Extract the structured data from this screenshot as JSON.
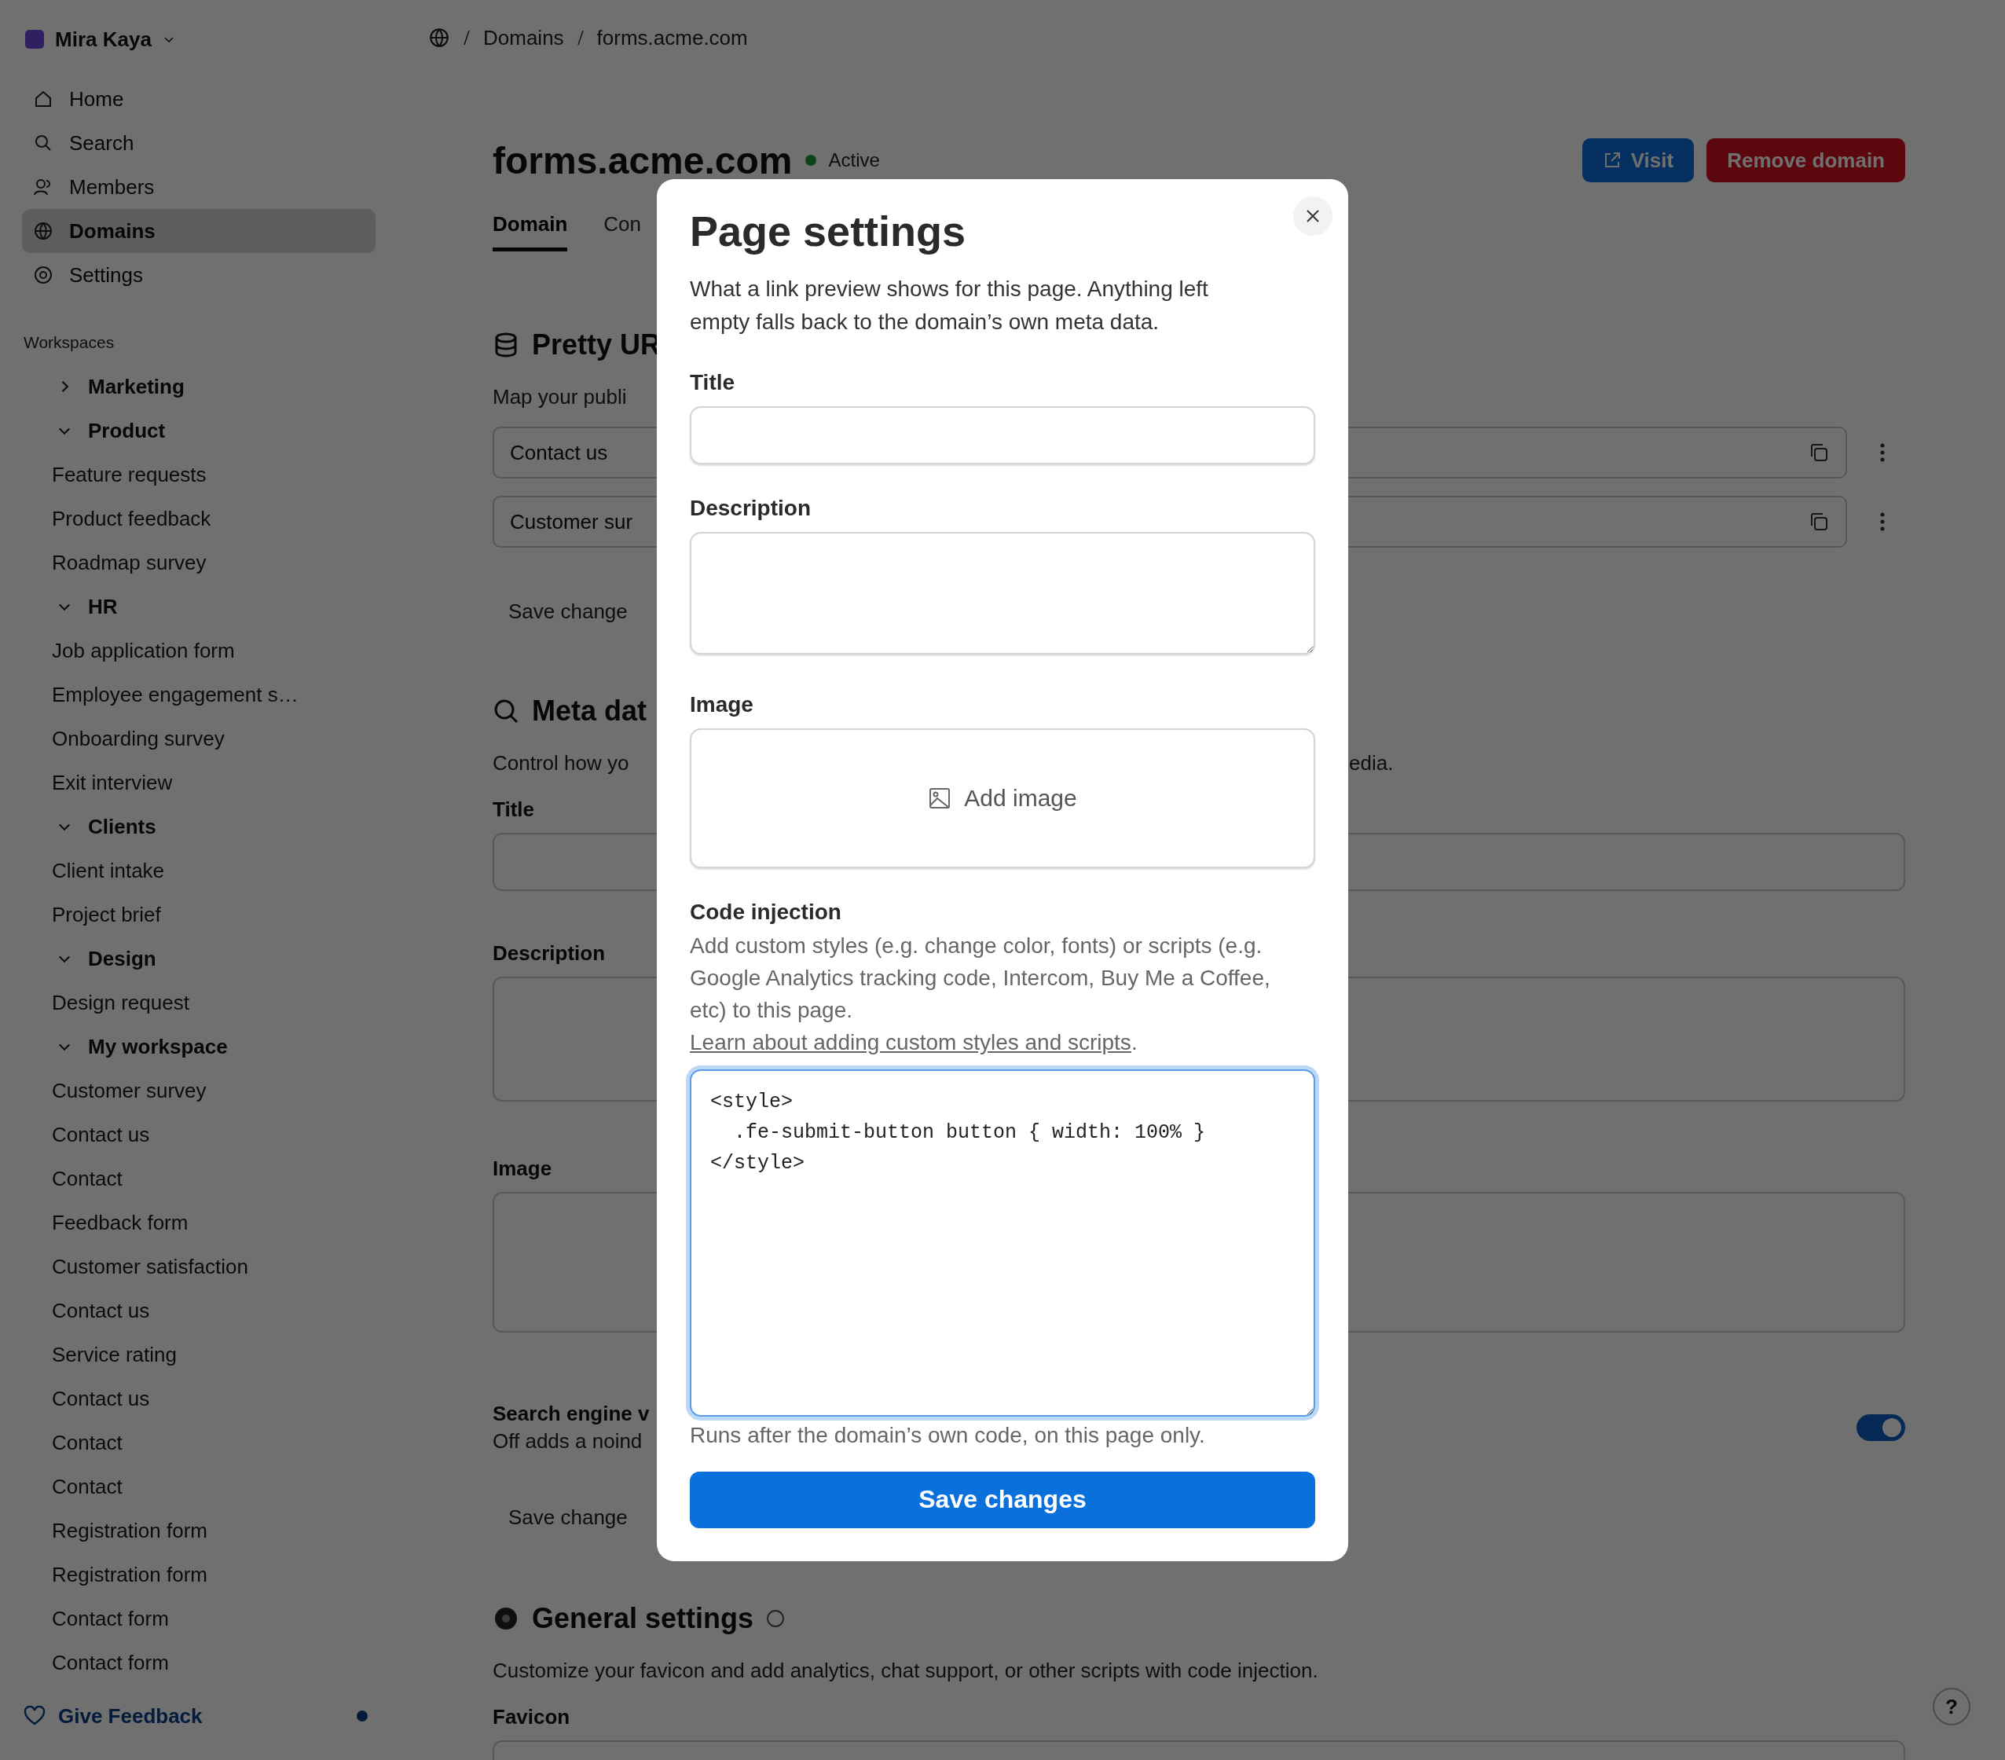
{
  "sidebar": {
    "workspace": "Mira Kaya",
    "nav": [
      {
        "label": "Home",
        "selected": false
      },
      {
        "label": "Search",
        "selected": false
      },
      {
        "label": "Members",
        "selected": false
      },
      {
        "label": "Domains",
        "selected": true
      },
      {
        "label": "Settings",
        "selected": false
      }
    ],
    "section_title": "Workspaces",
    "tree": [
      {
        "label": "Marketing",
        "expanded": false
      },
      {
        "label": "Product",
        "expanded": true,
        "children": [
          "Feature requests",
          "Product feedback",
          "Roadmap survey"
        ]
      },
      {
        "label": "HR",
        "expanded": true,
        "children": [
          "Job application form",
          "Employee engagement s…",
          "Onboarding survey",
          "Exit interview"
        ]
      },
      {
        "label": "Clients",
        "expanded": true,
        "children": [
          "Client intake",
          "Project brief"
        ]
      },
      {
        "label": "Design",
        "expanded": true,
        "children": [
          "Design request"
        ]
      },
      {
        "label": "My workspace",
        "expanded": true,
        "children": [
          "Customer survey",
          "Contact us",
          "Contact",
          "Feedback form",
          "Customer satisfaction",
          "Contact us",
          "Service rating",
          "Contact us",
          "Contact",
          "Contact",
          "Registration form",
          "Registration form",
          "Contact form",
          "Contact form"
        ]
      }
    ],
    "feedback": "Give Feedback",
    "feedback_unread": true
  },
  "breadcrumb": [
    "Domains",
    "forms.acme.com"
  ],
  "header": {
    "title": "forms.acme.com",
    "status": "Active",
    "buttons": [
      {
        "label": "Visit",
        "kind": "primary"
      },
      {
        "label": "Remove domain",
        "kind": "danger"
      }
    ]
  },
  "tabs": [
    {
      "label": "Domain",
      "selected": true
    },
    {
      "label": "Con",
      "selected": false
    }
  ],
  "pretty_urls": {
    "title": "Pretty UR",
    "description": "Map your publi",
    "rows": [
      "Contact us",
      "Customer sur"
    ],
    "save": "Save change"
  },
  "meta": {
    "title": "Meta dat",
    "description_start": "Control how yo",
    "description_end": "edia.",
    "fields": [
      "Title",
      "Description",
      "Image"
    ],
    "seo": {
      "title": "Search engine v",
      "note": "Off adds a noind",
      "on": true
    },
    "save": "Save change"
  },
  "general": {
    "title": "General settings",
    "description": "Customize your favicon and add analytics, chat support, or other scripts with code injection.",
    "field": "Favicon"
  },
  "help": "?",
  "modal": {
    "title": "Page settings",
    "intro": "What a link preview shows for this page. Anything left empty falls back to the domain’s own meta data.",
    "fields": [
      {
        "label": "Title",
        "kind": "input"
      },
      {
        "label": "Description",
        "kind": "textarea"
      },
      {
        "label": "Image",
        "kind": "image",
        "action": "Add image"
      }
    ],
    "code": {
      "label": "Code injection",
      "help": "Add custom styles (e.g. change color, fonts) or scripts (e.g. Google Analytics tracking code, Intercom, Buy Me a Coffee, etc) to this page.",
      "link": "Learn about adding custom styles and scripts",
      "help_end": ".",
      "value": "<style>\n  .fe-submit-button button { width: 100% }\n</style>",
      "focused": true,
      "note": "Runs after the domain’s own code, on this page only."
    },
    "save": "Save changes"
  }
}
